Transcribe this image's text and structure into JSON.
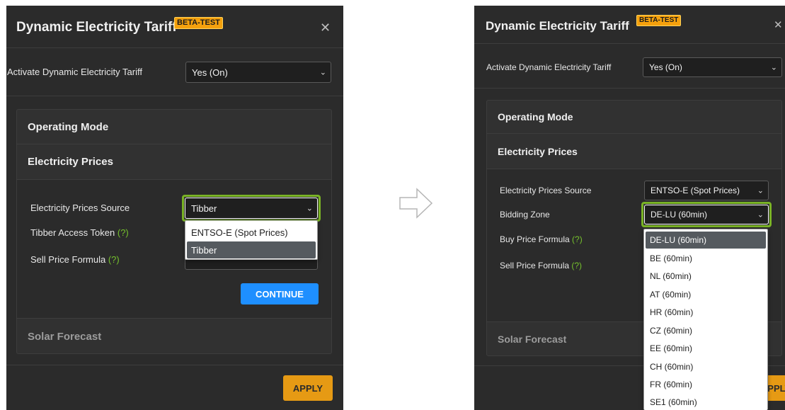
{
  "dialog": {
    "title": "Dynamic Electricity Tariff",
    "badge": "BETA-TEST",
    "close_glyph": "✕",
    "activate_label": "Activate Dynamic Electricity Tariff",
    "activate_value": "Yes (On)",
    "operating_mode": "Operating Mode",
    "electricity_prices": "Electricity Prices",
    "solar_forecast": "Solar Forecast",
    "apply_label": "APPLY"
  },
  "left": {
    "source_label": "Electricity Prices Source",
    "source_value": "Tibber",
    "token_label": "Tibber Access Token",
    "help": "(?)",
    "sell_label": "Sell Price Formula",
    "continue_label": "CONTINUE",
    "dropdown_options": [
      "ENTSO-E (Spot Prices)",
      "Tibber"
    ],
    "dropdown_selected": "Tibber"
  },
  "right": {
    "source_label": "Electricity Prices Source",
    "source_value": "ENTSO-E (Spot Prices)",
    "zone_label": "Bidding Zone",
    "zone_value": "DE-LU (60min)",
    "buy_label": "Buy Price Formula",
    "sell_label": "Sell Price Formula",
    "help": "(?)",
    "dropdown_options": [
      "DE-LU (60min)",
      "BE (60min)",
      "NL (60min)",
      "AT (60min)",
      "HR (60min)",
      "CZ (60min)",
      "EE (60min)",
      "CH (60min)",
      "FR (60min)",
      "SE1 (60min)"
    ],
    "dropdown_selected": "DE-LU (60min)"
  },
  "icons": {
    "chevron": "chevron-down-icon",
    "arrow": "right-arrow-icon"
  },
  "colors": {
    "panel_bg": "#2b2b2b",
    "badge": "#f5a10d",
    "highlight_ring": "#7ab325",
    "help_green": "#75c12c",
    "continue_blue": "#1e8fff",
    "apply_orange": "#e69a14"
  }
}
